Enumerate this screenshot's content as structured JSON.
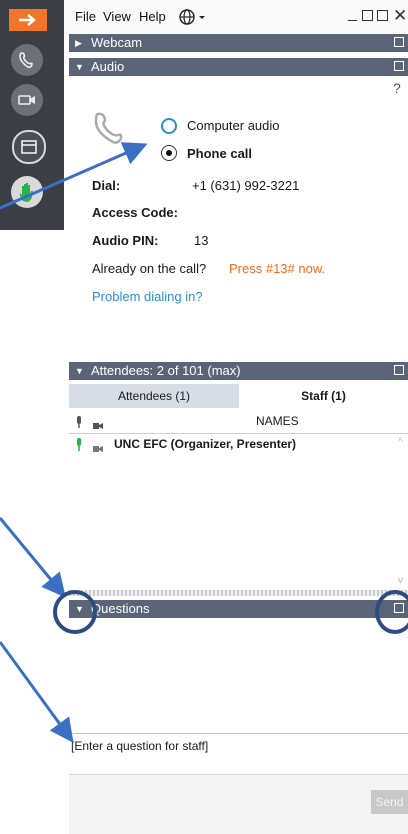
{
  "menu": {
    "file": "File",
    "view": "View",
    "help": "Help"
  },
  "sections": {
    "webcam": "Webcam",
    "audio": "Audio",
    "attendees": "Attendees:  2 of 101 (max)",
    "questions": "Questions"
  },
  "audio": {
    "help_mark": "?",
    "option_computer": "Computer audio",
    "option_phone": "Phone call",
    "selected_option": "Phone call",
    "dial_label": "Dial:",
    "dial_value": "+1 (631) 992-3221",
    "access_code_label": "Access Code:",
    "access_code_value": "",
    "audio_pin_label": "Audio PIN:",
    "audio_pin_value": "13",
    "already_text": "Already on the call?",
    "press_text": "Press #13# now.",
    "problem_link": "Problem dialing in?"
  },
  "attendees": {
    "tabs": [
      {
        "label": "Attendees (1)",
        "active": false
      },
      {
        "label": "Staff (1)",
        "active": true
      }
    ],
    "column_header": "NAMES",
    "rows": [
      {
        "name": "UNC EFC (Organizer, Presenter)",
        "mic_on": true
      }
    ]
  },
  "questions": {
    "input_text": "[Enter a question for staff]",
    "send_label": "Send"
  },
  "colors": {
    "toolbar_bg": "#3b3f45",
    "accent_orange": "#f0742a",
    "section_bar": "#5a6578",
    "link_blue": "#2a8fd4",
    "press_orange": "#f36c21",
    "mic_green": "#2bb24c",
    "annotation_blue": "#3a6fc4",
    "annotation_circle": "#2f4b80"
  },
  "icons": {
    "leave": "arrow-right-icon",
    "phone": "phone-icon",
    "camera": "camera-icon",
    "whiteboard": "whiteboard-icon",
    "raise_hand": "raise-hand-icon",
    "globe": "globe-icon",
    "mic": "microphone-icon",
    "cam_col": "webcam-icon",
    "popout": "popout-icon"
  }
}
